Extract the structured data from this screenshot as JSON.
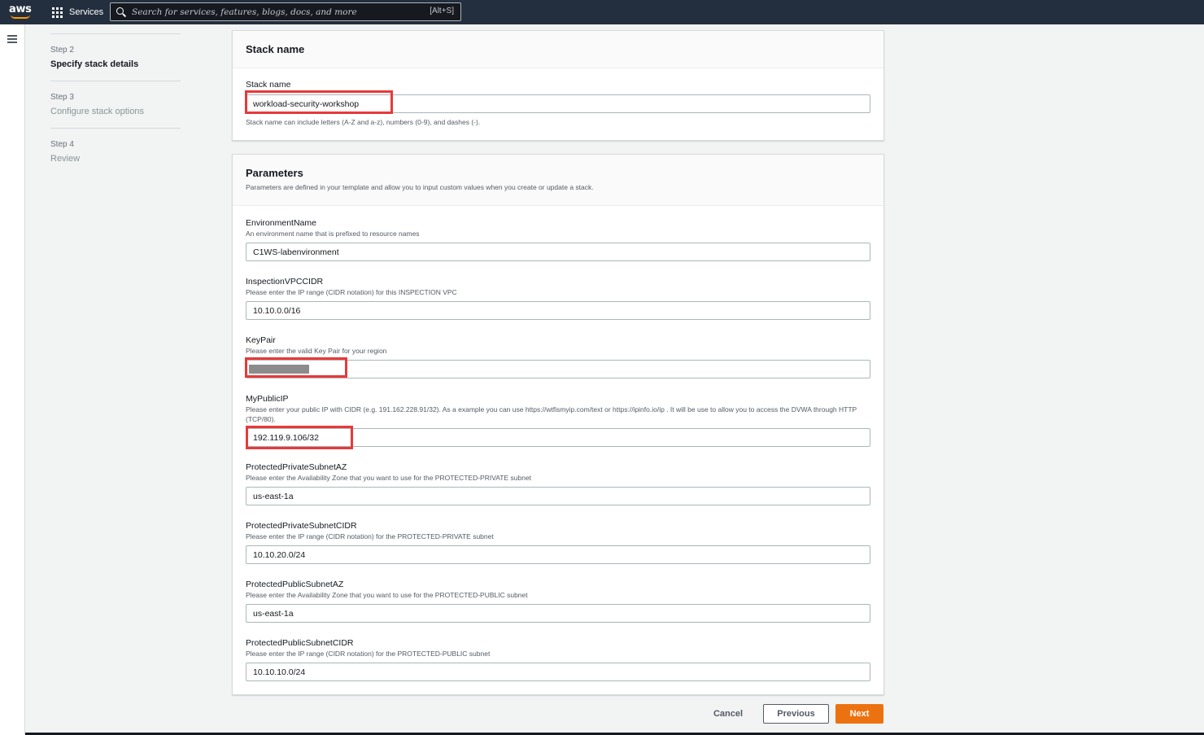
{
  "nav": {
    "logo_text": "aws",
    "services_label": "Services",
    "search_placeholder": "Search for services, features, blogs, docs, and more",
    "search_shortcut": "[Alt+S]"
  },
  "steps": [
    {
      "number": "Step 2",
      "title": "Specify stack details",
      "active": true
    },
    {
      "number": "Step 3",
      "title": "Configure stack options",
      "active": false
    },
    {
      "number": "Step 4",
      "title": "Review",
      "active": false
    }
  ],
  "stack_name_panel": {
    "title": "Stack name",
    "field_label": "Stack name",
    "value": "workload-security-workshop",
    "hint": "Stack name can include letters (A-Z and a-z), numbers (0-9), and dashes (-)."
  },
  "parameters_panel": {
    "title": "Parameters",
    "description": "Parameters are defined in your template and allow you to input custom values when you create or update a stack.",
    "fields": [
      {
        "label": "EnvironmentName",
        "description": "An environment name that is prefixed to resource names",
        "value": "C1WS-labenvironment"
      },
      {
        "label": "InspectionVPCCIDR",
        "description": "Please enter the IP range (CIDR notation) for this INSPECTION VPC",
        "value": "10.10.0.0/16"
      },
      {
        "label": "KeyPair",
        "description": "Please enter the valid Key Pair for your region",
        "value": ""
      },
      {
        "label": "MyPublicIP",
        "description": "Please enter your public IP with CIDR (e.g. 191.162.228.91/32). As a example you can use https://wtfismyip.com/text or https://ipinfo.io/ip . It will be use to allow you to access the DVWA through HTTP (TCP/80).",
        "value": "192.119.9.106/32"
      },
      {
        "label": "ProtectedPrivateSubnetAZ",
        "description": "Please enter the Availability Zone that you want to use for the PROTECTED-PRIVATE subnet",
        "value": "us-east-1a"
      },
      {
        "label": "ProtectedPrivateSubnetCIDR",
        "description": "Please enter the IP range (CIDR notation) for the PROTECTED-PRIVATE subnet",
        "value": "10.10.20.0/24"
      },
      {
        "label": "ProtectedPublicSubnetAZ",
        "description": "Please enter the Availability Zone that you want to use for the PROTECTED-PUBLIC subnet",
        "value": "us-east-1a"
      },
      {
        "label": "ProtectedPublicSubnetCIDR",
        "description": "Please enter the IP range (CIDR notation) for the PROTECTED-PUBLIC subnet",
        "value": "10.10.10.0/24"
      }
    ]
  },
  "footer": {
    "cancel_label": "Cancel",
    "previous_label": "Previous",
    "next_label": "Next"
  },
  "colors": {
    "nav_bg": "#232f3e",
    "accent_orange": "#ec7211",
    "highlight_red": "#e8393a"
  }
}
